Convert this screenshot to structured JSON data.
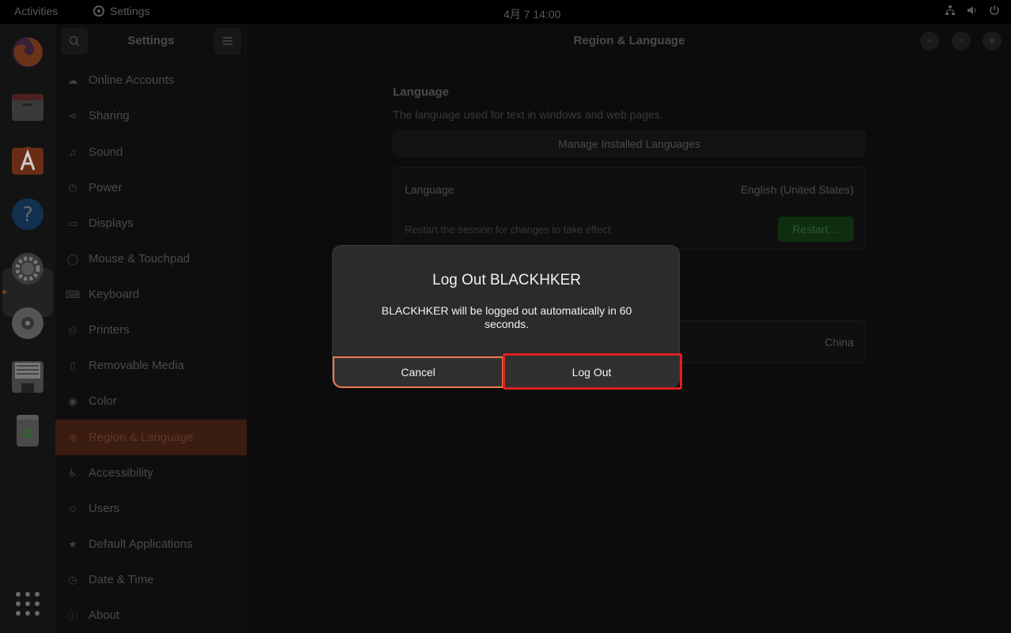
{
  "topbar": {
    "activities": "Activities",
    "app_name": "Settings",
    "clock": "4月 7  14:00",
    "tray_icons": [
      "network-icon",
      "volume-icon",
      "power-icon"
    ]
  },
  "dock": {
    "apps": [
      "firefox-icon",
      "files-icon",
      "app-center-icon",
      "help-icon",
      "settings-icon",
      "disc-icon",
      "floppy-icon",
      "trash-icon"
    ],
    "show_apps": "show-apps-icon"
  },
  "sidebar": {
    "title": "Settings",
    "items": [
      {
        "label": "Online Accounts",
        "icon": "cloud-icon"
      },
      {
        "label": "Sharing",
        "icon": "share-icon"
      },
      {
        "label": "Sound",
        "icon": "music-note-icon"
      },
      {
        "label": "Power",
        "icon": "power-icon"
      },
      {
        "label": "Displays",
        "icon": "display-icon"
      },
      {
        "label": "Mouse & Touchpad",
        "icon": "mouse-icon"
      },
      {
        "label": "Keyboard",
        "icon": "keyboard-icon"
      },
      {
        "label": "Printers",
        "icon": "printer-icon"
      },
      {
        "label": "Removable Media",
        "icon": "usb-icon"
      },
      {
        "label": "Color",
        "icon": "color-icon"
      },
      {
        "label": "Region & Language",
        "icon": "globe-icon",
        "active": true
      },
      {
        "label": "Accessibility",
        "icon": "accessibility-icon"
      },
      {
        "label": "Users",
        "icon": "users-icon"
      },
      {
        "label": "Default Applications",
        "icon": "star-icon"
      },
      {
        "label": "Date & Time",
        "icon": "clock-icon"
      },
      {
        "label": "About",
        "icon": "info-icon"
      }
    ]
  },
  "main": {
    "title": "Region & Language",
    "language_section": {
      "title": "Language",
      "description": "The language used for text in windows and web pages.",
      "manage_button": "Manage Installed Languages",
      "row_label": "Language",
      "row_value": "English (United States)",
      "restart_note": "Restart the session for changes to take effect",
      "restart_button": "Restart…"
    },
    "formats_value": "China"
  },
  "dialog": {
    "title": "Log Out BLACKHKER",
    "message": "BLACKHKER will be logged out automatically in 60 seconds.",
    "cancel_label": "Cancel",
    "logout_label": "Log Out"
  },
  "colors": {
    "accent": "#e97c4e",
    "highlight": "#e0201f",
    "dialog_bg": "#2b2b2b"
  }
}
